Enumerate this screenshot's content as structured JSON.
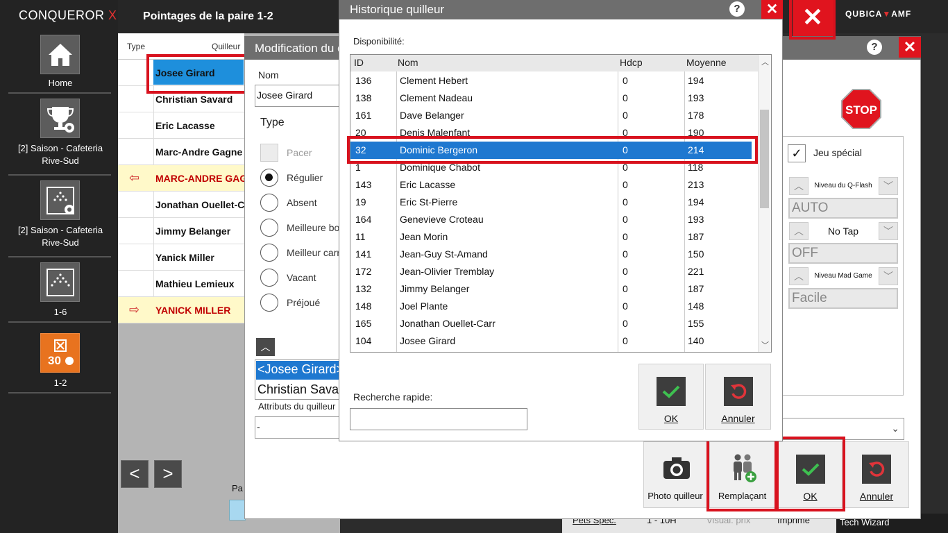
{
  "app": {
    "brand": "CONQUEROR",
    "brand_x": "X",
    "page_title": "Pointages de la paire 1-2",
    "vendor_left": "QUBICA",
    "vendor_right": "AMF",
    "colors": {
      "accent_red": "#e0141e",
      "selection_blue": "#1e78d0",
      "tile_orange": "#e8731f"
    }
  },
  "sidebar": {
    "items": [
      {
        "label": "Home",
        "icon": "home-icon"
      },
      {
        "label": "[2] Saison - Cafeteria Rive-Sud",
        "icon": "trophy-gear-icon"
      },
      {
        "label": "[2] Saison - Cafeteria Rive-Sud",
        "icon": "pins-gear-icon"
      },
      {
        "label": "1-6",
        "icon": "pins-icon"
      },
      {
        "label": "1-2",
        "icon": "score-30-icon"
      }
    ]
  },
  "main": {
    "col_type": "Type",
    "col_player": "Quilleur",
    "players": [
      "Josee Girard",
      "Christian Savard",
      "Eric Lacasse",
      "Marc-Andre Gagne",
      "MARC-ANDRE GAGNE",
      "Jonathan Ouellet-Carr",
      "Jimmy Belanger",
      "Yanick Miller",
      "Mathieu Lemieux",
      "YANICK MILLER"
    ],
    "prev": "<",
    "next": ">",
    "bottom_partial": "Pa",
    "bottom_tabs": [
      "Pets Spec.",
      "1 - 10H",
      "Visual. prix",
      "Imprime"
    ],
    "tech_wizard": "Tech Wizard"
  },
  "modif": {
    "title": "Modification du quilleur",
    "nom_label": "Nom",
    "nom_value": "Josee Girard",
    "type_label": "Type",
    "types": [
      "Pacer",
      "Régulier",
      "Absent",
      "Meilleure boule",
      "Meilleur carreau",
      "Vacant",
      "Préjoué"
    ],
    "list_items": [
      "<Josee Girard>",
      "Christian Savard"
    ],
    "attributs_label": "Attributs du quilleur",
    "attributs_value": "-",
    "jeu_special": "Jeu spécial",
    "qflash_label": "Niveau du Q-Flash",
    "qflash_value": "AUTO",
    "notap_label": "No Tap",
    "notap_value": "OFF",
    "madgame_label": "Niveau Mad Game",
    "madgame_value": "Facile",
    "stop": "STOP",
    "btn_photo": "Photo quilleur",
    "btn_remplacant": "Remplaçant",
    "btn_ok": "OK",
    "btn_annuler": "Annuler"
  },
  "historique": {
    "title": "Historique quilleur",
    "disponibilite": "Disponibilité:",
    "columns": [
      "ID",
      "Nom",
      "Hdcp",
      "Moyenne"
    ],
    "rows": [
      [
        "136",
        "Clement Hebert",
        "0",
        "194"
      ],
      [
        "138",
        "Clement Nadeau",
        "0",
        "193"
      ],
      [
        "161",
        "Dave Belanger",
        "0",
        "178"
      ],
      [
        "20",
        "Denis Malenfant",
        "0",
        "190"
      ],
      [
        "32",
        "Dominic Bergeron",
        "0",
        "214"
      ],
      [
        "1",
        "Dominique Chabot",
        "0",
        "118"
      ],
      [
        "143",
        "Eric Lacasse",
        "0",
        "213"
      ],
      [
        "19",
        "Eric St-Pierre",
        "0",
        "194"
      ],
      [
        "164",
        "Genevieve Croteau",
        "0",
        "193"
      ],
      [
        "11",
        "Jean Morin",
        "0",
        "187"
      ],
      [
        "141",
        "Jean-Guy St-Amand",
        "0",
        "150"
      ],
      [
        "172",
        "Jean-Olivier Tremblay",
        "0",
        "221"
      ],
      [
        "132",
        "Jimmy Belanger",
        "0",
        "187"
      ],
      [
        "148",
        "Joel Plante",
        "0",
        "148"
      ],
      [
        "165",
        "Jonathan Ouellet-Carr",
        "0",
        "155"
      ],
      [
        "104",
        "Josee Girard",
        "0",
        "140"
      ]
    ],
    "selected_index": 4,
    "search_label": "Recherche rapide:",
    "search_value": "",
    "ok": "OK",
    "annuler": "Annuler"
  }
}
